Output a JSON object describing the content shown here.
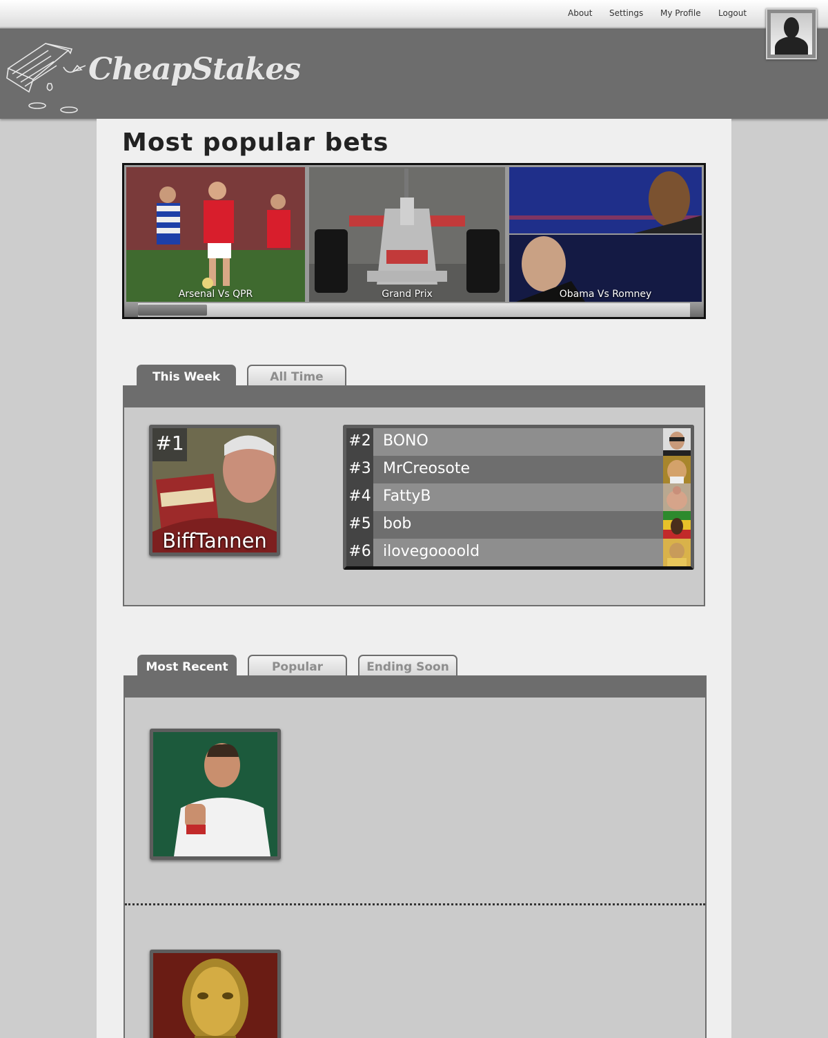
{
  "nav": {
    "about": "About",
    "settings": "Settings",
    "profile": "My Profile",
    "logout": "Logout"
  },
  "brand": {
    "name": "CheapStakes"
  },
  "page_title": "Most popular bets",
  "carousel": {
    "slides": [
      {
        "caption": "Arsenal Vs QPR",
        "icon": "football-photo"
      },
      {
        "caption": "Grand Prix",
        "icon": "f1-car-photo"
      },
      {
        "caption": "Obama Vs Romney",
        "icon": "debate-photo"
      }
    ]
  },
  "leaderboard": {
    "tabs": [
      "This Week",
      "All Time"
    ],
    "active_tab": "This Week",
    "first": {
      "rank": "#1",
      "name": "BiffTannen"
    },
    "others": [
      {
        "rank": "#2",
        "name": "BONO"
      },
      {
        "rank": "#3",
        "name": "MrCreosote"
      },
      {
        "rank": "#4",
        "name": "FattyB"
      },
      {
        "rank": "#5",
        "name": "bob"
      },
      {
        "rank": "#6",
        "name": "ilovegoooold"
      }
    ]
  },
  "feed": {
    "tabs": [
      "Most Recent",
      "Popular",
      "Ending Soon"
    ],
    "active_tab": "Most Recent"
  },
  "colors": {
    "header": "#6d6d6d",
    "content": "#efefef",
    "panel": "#cbcbcb",
    "row_light": "#8e8e8e",
    "row_dark": "#6e6e6e"
  }
}
